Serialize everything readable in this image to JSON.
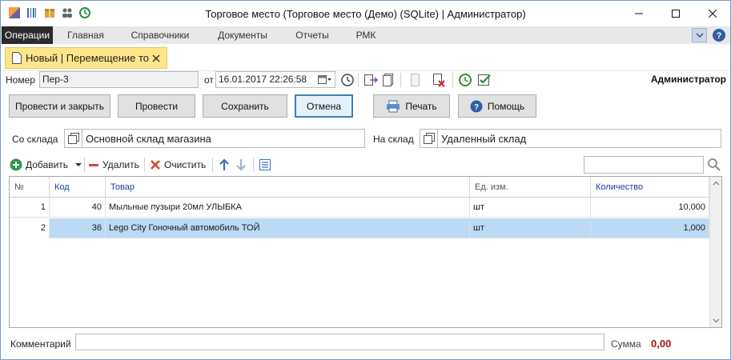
{
  "window": {
    "title": "Торговое место (Торговое место (Демо) (SQLite) | Администратор)"
  },
  "menu": {
    "items": [
      "Операции",
      "Главная",
      "Справочники",
      "Документы",
      "Отчеты",
      "РМК"
    ],
    "active_index": 0
  },
  "document_tab": {
    "label": "Новый | Перемещение то..."
  },
  "header": {
    "number_label": "Номер",
    "number_value": "Пер-3",
    "date_label": "от",
    "date_value": "16.01.2017 22:26:58",
    "user": "Администратор"
  },
  "actions": {
    "post_close": "Провести и закрыть",
    "post": "Провести",
    "save": "Сохранить",
    "cancel": "Отмена",
    "print": "Печать",
    "help": "Помощь"
  },
  "warehouses": {
    "from_label": "Со склада",
    "from_value": "Основной склад магазина",
    "to_label": "На склад",
    "to_value": "Удаленный склад"
  },
  "grid_toolbar": {
    "add": "Добавить",
    "delete": "Удалить",
    "clear": "Очистить",
    "search_value": ""
  },
  "grid": {
    "columns": [
      "№",
      "Код",
      "Товар",
      "Ед. изм.",
      "Количество"
    ],
    "rows": [
      {
        "n": "1",
        "code": "40",
        "item": "Мыльные пузыри 20мл УЛЫБКА",
        "unit": "шт",
        "qty": "10,000"
      },
      {
        "n": "2",
        "code": "36",
        "item": "Lego City Гоночный автомобиль ТОЙ",
        "unit": "шт",
        "qty": "1,000"
      }
    ],
    "selected_row": 1
  },
  "footer": {
    "comment_label": "Комментарий",
    "comment_value": "",
    "sum_label": "Сумма",
    "sum_value": "0,00"
  },
  "colors": {
    "accent": "#3c7fb1",
    "tab_bg": "#fde68a",
    "selection": "#bcd9f5",
    "sum": "#a31515",
    "menu_active": "#2b2b2b"
  }
}
